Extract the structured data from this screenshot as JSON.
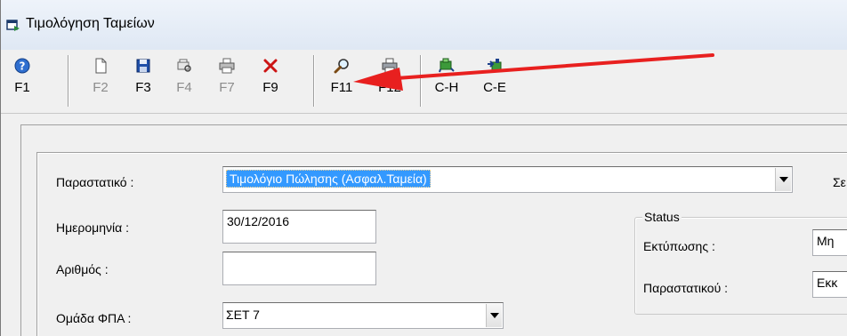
{
  "window": {
    "title": "Τιμολόγηση Ταμείων"
  },
  "toolbar": {
    "buttons": [
      {
        "label": "F1",
        "icon": "help-icon"
      },
      {
        "label": "F2",
        "icon": "new-document-icon"
      },
      {
        "label": "F3",
        "icon": "save-icon"
      },
      {
        "label": "F4",
        "icon": "print-preview-icon"
      },
      {
        "label": "F7",
        "icon": "printer-icon"
      },
      {
        "label": "F9",
        "icon": "delete-icon"
      },
      {
        "label": "F11",
        "icon": "search-icon"
      },
      {
        "label": "F12",
        "icon": "printer-icon"
      },
      {
        "label": "C-H",
        "icon": "machine-icon"
      },
      {
        "label": "C-E",
        "icon": "export-icon"
      }
    ]
  },
  "form": {
    "document_label": "Παραστατικό :",
    "document_value": "Τιμολόγιο Πώλησης (Ασφαλ.Ταμεία)",
    "right_label_partial": "Σε",
    "date_label": "Ημερομηνία :",
    "date_value": "30/12/2016",
    "number_label": "Αριθμός :",
    "number_value": "",
    "vat_label": "Ομάδα ΦΠΑ :",
    "vat_value": "ΣΕΤ 7"
  },
  "status": {
    "title": "Status",
    "printing_label": "Εκτύπωσης :",
    "printing_value": "Μη",
    "document_label": "Παραστατικού :",
    "document_value": "Εκκ"
  },
  "colors": {
    "annotation_arrow": "#e8201f",
    "selection": "#3399ff"
  }
}
